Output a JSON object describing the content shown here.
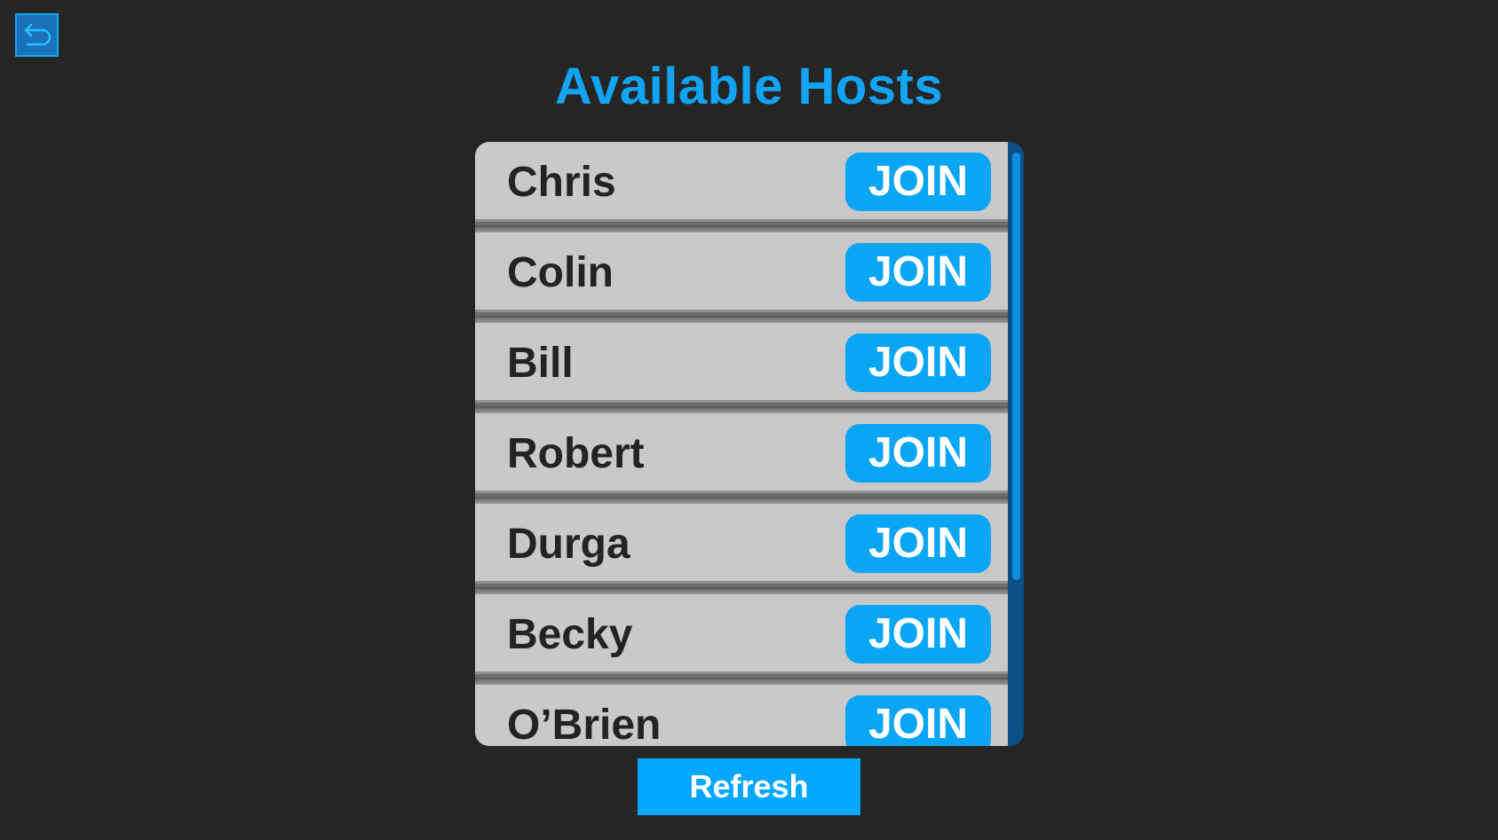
{
  "screen": {
    "title": "Available Hosts",
    "back_icon": "undo-arrow-icon"
  },
  "hosts": [
    {
      "name": "Chris",
      "join_label": "JOIN"
    },
    {
      "name": "Colin",
      "join_label": "JOIN"
    },
    {
      "name": "Bill",
      "join_label": "JOIN"
    },
    {
      "name": "Robert",
      "join_label": "JOIN"
    },
    {
      "name": "Durga",
      "join_label": "JOIN"
    },
    {
      "name": "Becky",
      "join_label": "JOIN"
    },
    {
      "name": "O’Brien",
      "join_label": "JOIN"
    }
  ],
  "actions": {
    "refresh_label": "Refresh"
  },
  "colors": {
    "background": "#252525",
    "accent": "#12a3f3",
    "row": "#c9c9c9",
    "scrollbar_track": "#0c4f86",
    "scrollbar_thumb": "#0d8de0"
  }
}
